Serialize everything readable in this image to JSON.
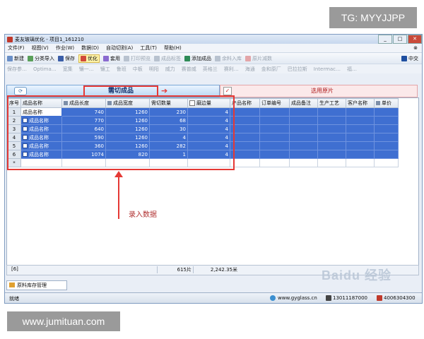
{
  "watermark_top": "TG: MYYJJPP",
  "watermark_bottom": "www.jumituan.com",
  "window": {
    "title": "麦友玻璃优化 - 项目1_161210",
    "min": "_",
    "max": "□",
    "close": "✕"
  },
  "menu": [
    "文件(F)",
    "视图(V)",
    "作业(W)",
    "数据(D)",
    "自动切割(A)",
    "工具(T)",
    "帮助(H)"
  ],
  "toolbar1": {
    "new": "新建",
    "import": "分类导入",
    "save": "保存",
    "optimize": "优化",
    "apply": "套用",
    "print": "打印预览",
    "product": "成品标签",
    "add_product": "添加成品",
    "glass_in": "余料入库",
    "glass_out": "原片减数",
    "language": "中交"
  },
  "toolbar3": [
    "保存参…",
    "Optima…",
    "宽集",
    "镶一…",
    "镶工",
    "鲁班",
    "中板",
    "明阳",
    "威力",
    "赛普威",
    "英格兰",
    "赛利…",
    "海通",
    "金和原厂",
    "巴拉拉斯",
    "Intermac…",
    "福…"
  ],
  "tabs": {
    "cut_products": "需切成品",
    "selected_sheets": "选用原片"
  },
  "grid": {
    "columns": [
      "序号",
      "成品名称",
      "成品长度",
      "成品宽度",
      "需切数量",
      "磨边量",
      "产品名称",
      "订单编号",
      "成品备注",
      "生产工艺",
      "客户名称",
      "单价"
    ],
    "rows": [
      {
        "no": "1",
        "name": "成品名称",
        "length": "740",
        "width": "1260",
        "qty": "230",
        "edge": "4"
      },
      {
        "no": "2",
        "name": "成品名称",
        "length": "770",
        "width": "1260",
        "qty": "68",
        "edge": "4"
      },
      {
        "no": "3",
        "name": "成品名称",
        "length": "640",
        "width": "1260",
        "qty": "30",
        "edge": "4"
      },
      {
        "no": "4",
        "name": "成品名称",
        "length": "590",
        "width": "1260",
        "qty": "4",
        "edge": "4"
      },
      {
        "no": "5",
        "name": "成品名称",
        "length": "360",
        "width": "1260",
        "qty": "282",
        "edge": "4"
      },
      {
        "no": "6",
        "name": "成品名称",
        "length": "1074",
        "width": "820",
        "qty": "1",
        "edge": "4"
      }
    ],
    "new_row_marker": "*"
  },
  "annotation": "录入数据",
  "totals": {
    "rows": "[6]",
    "pieces": "615片",
    "area": "2,242.35米"
  },
  "bottom_tab": "原料库存管理",
  "status": {
    "ready": "就绪",
    "website": "www.gyglass.cn",
    "phone1": "13011187000",
    "phone2": "4006304300"
  },
  "baidu_text": "Baidu 经验",
  "colors": {
    "selection": "#3f6fd1",
    "highlight_red": "#e53935",
    "window_bg": "#e9eef6"
  }
}
